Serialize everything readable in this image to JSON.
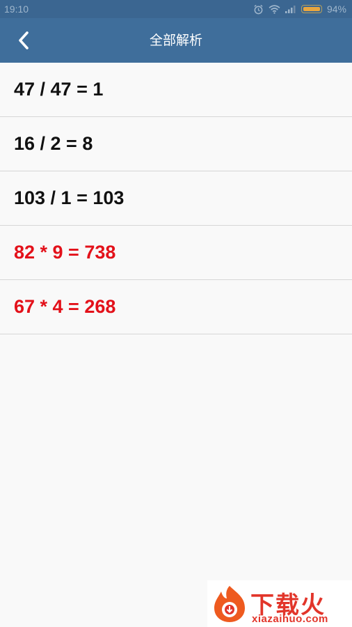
{
  "status_bar": {
    "time": "19:10",
    "battery_percent": "94%"
  },
  "header": {
    "title": "全部解析",
    "back_icon": "chevron-left-icon"
  },
  "results": [
    {
      "expression": "47 / 47 = 1",
      "correct": true
    },
    {
      "expression": "16 / 2 = 8",
      "correct": true
    },
    {
      "expression": "103 / 1 = 103",
      "correct": true
    },
    {
      "expression": "82 * 9 = 738",
      "correct": false
    },
    {
      "expression": "67 * 4 = 268",
      "correct": false
    }
  ],
  "colors": {
    "header_bg": "#3f6e9b",
    "correct_text": "#111111",
    "wrong_text": "#e3111a"
  },
  "watermark": {
    "brand": "下载火",
    "domain": "xiazaihuo.com"
  }
}
